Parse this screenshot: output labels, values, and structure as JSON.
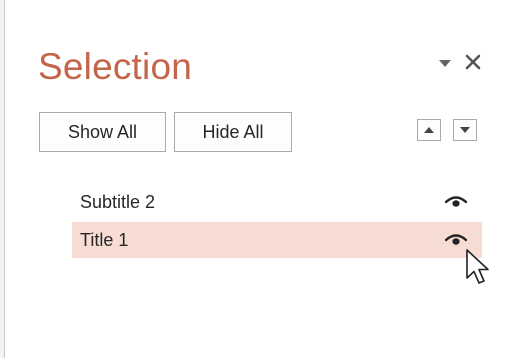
{
  "pane": {
    "title": "Selection",
    "menu_icon": "dropdown-triangle-icon",
    "close_icon": "close-icon"
  },
  "toolbar": {
    "show_all_label": "Show All",
    "hide_all_label": "Hide All",
    "bring_forward_icon": "arrow-up-icon",
    "send_backward_icon": "arrow-down-icon"
  },
  "items": [
    {
      "label": "Subtitle 2",
      "visible": true,
      "selected": false,
      "icon": "eye-icon"
    },
    {
      "label": "Title 1",
      "visible": true,
      "selected": true,
      "icon": "eye-icon"
    }
  ],
  "colors": {
    "title": "#c4654b",
    "selected_row": "#f7dcd4",
    "border": "#ababab"
  }
}
